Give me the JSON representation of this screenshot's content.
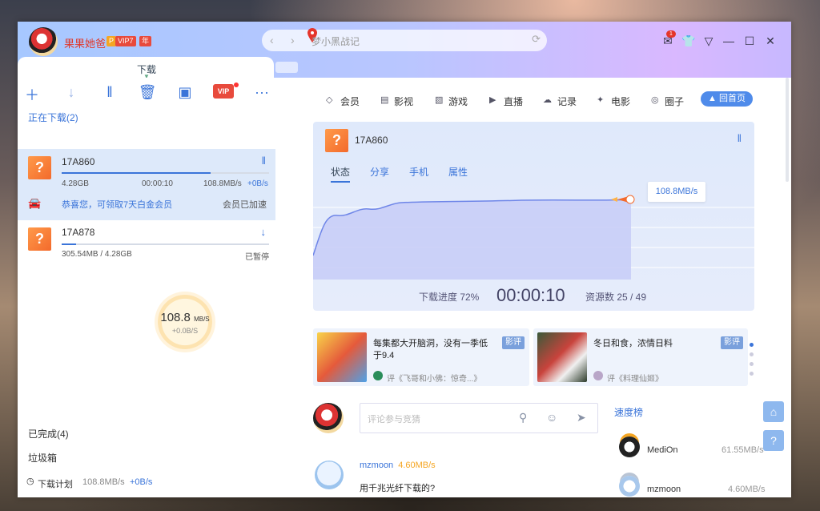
{
  "user": {
    "name": "果果她爸",
    "badge_p": "P",
    "badge_vip": "VIP7",
    "badge_year": "年"
  },
  "search": {
    "placeholder": "梦小黑战记"
  },
  "tabs": {
    "download": "下载"
  },
  "left": {
    "downloading_header": "正在下载(2)",
    "items": [
      {
        "name": "17A860",
        "size": "4.28GB",
        "time": "00:00:10",
        "speed": "108.8MB/s",
        "extra": "+0B/s",
        "progress": 0.72,
        "promo": "恭喜您，可领取7天白金会员",
        "status": "会员已加速"
      },
      {
        "name": "17A878",
        "size": "305.54MB / 4.28GB",
        "status": "已暂停",
        "progress": 0.07
      }
    ],
    "speed": {
      "value": "108.8",
      "unit": "MB/S",
      "delta": "+0.0B/S"
    },
    "completed": "已完成(4)",
    "trash": "垃圾箱",
    "plan_label": "下载计划",
    "plan_speed": "108.8MB/s",
    "plan_extra": "+0B/s"
  },
  "nav": {
    "items": [
      "会员",
      "影视",
      "游戏",
      "直播",
      "记录",
      "电影",
      "圈子"
    ],
    "home": "回首页"
  },
  "panel": {
    "name": "17A860",
    "tabs": [
      "状态",
      "分享",
      "手机",
      "属性"
    ],
    "tooltip": "108.8MB/s",
    "progress_text": "下载进度 72%",
    "elapsed": "00:00:10",
    "sources": "资源数 25 / 49"
  },
  "cards": [
    {
      "title": "每集都大开脑洞，没有一季低于9.4",
      "tag": "影评",
      "meta": "评《飞哥和小佛：惊奇...》"
    },
    {
      "title": "冬日和食，浓情日料",
      "tag": "影评",
      "meta": "评《料理仙姬》"
    }
  ],
  "comment": {
    "placeholder": "评论参与竞猜"
  },
  "ranking": {
    "title": "速度榜",
    "items": [
      {
        "name": "MediOn",
        "speed": "61.55MB/s"
      },
      {
        "name": "mzmoon",
        "speed": "4.60MB/s"
      }
    ]
  },
  "post": {
    "user": "mzmoon",
    "speed": "4.60MB/s",
    "text": "用千兆光纤下载的?"
  },
  "colors": {
    "accent": "#3a74d9",
    "vip": "#e84a3c",
    "orange": "#f36a2c"
  }
}
